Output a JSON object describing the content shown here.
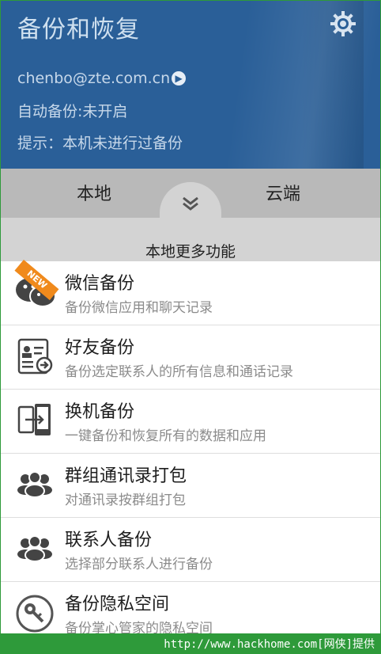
{
  "header": {
    "title": "备份和恢复",
    "email": "chenbo@zte.com.cn",
    "auto_backup": "自动备份:未开启",
    "hint": "提示：本机未进行过备份"
  },
  "tabs": [
    {
      "label": "本地"
    },
    {
      "label": "云端"
    }
  ],
  "more": {
    "label": "本地更多功能"
  },
  "items": [
    {
      "title": "微信备份",
      "subtitle": "备份微信应用和聊天记录",
      "badge": "NEW"
    },
    {
      "title": "好友备份",
      "subtitle": "备份选定联系人的所有信息和通话记录"
    },
    {
      "title": "换机备份",
      "subtitle": "一键备份和恢复所有的数据和应用"
    },
    {
      "title": "群组通讯录打包",
      "subtitle": "对通讯录按群组打包"
    },
    {
      "title": "联系人备份",
      "subtitle": "选择部分联系人进行备份"
    },
    {
      "title": "备份隐私空间",
      "subtitle": "备份掌心管家的隐私空间"
    }
  ],
  "footer": {
    "watermark": "http://www.hackhome.com[网侠]提供"
  },
  "colors": {
    "header_bg": "#2a5f98",
    "tab_bg": "#b9b9b9",
    "footer_bg": "#2e9a3a",
    "badge": "#f08a1c"
  }
}
